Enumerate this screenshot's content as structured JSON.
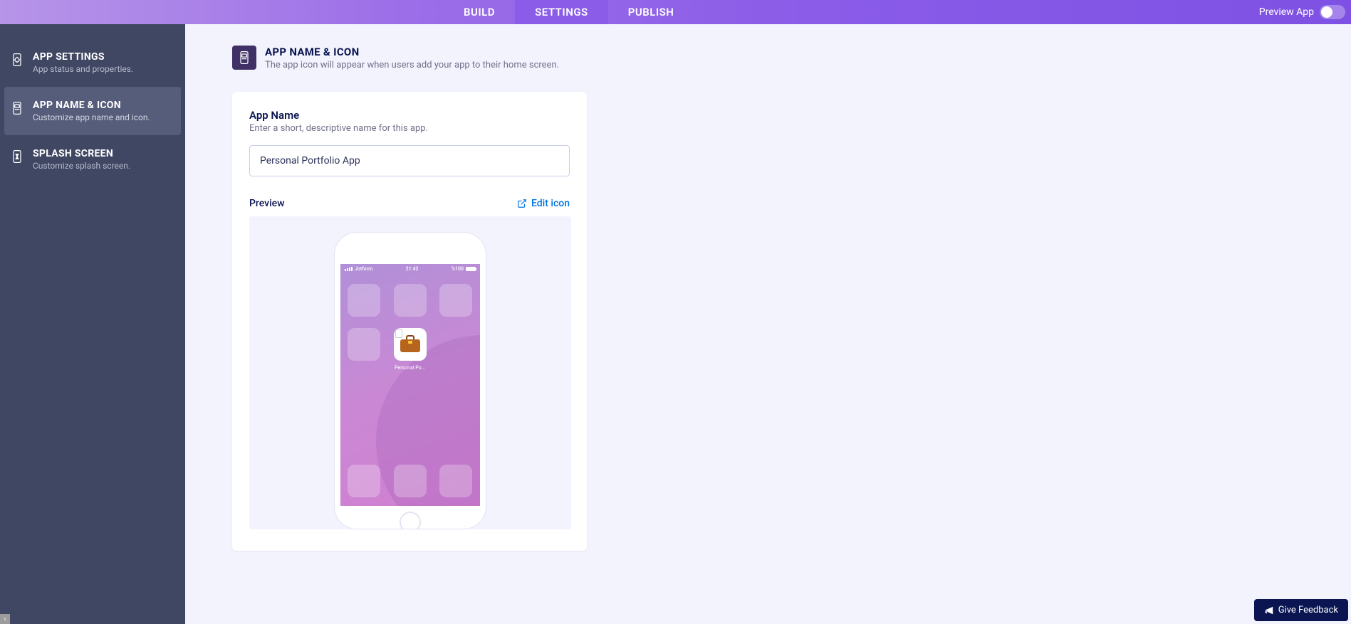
{
  "topbar": {
    "tabs": [
      {
        "label": "BUILD"
      },
      {
        "label": "SETTINGS"
      },
      {
        "label": "PUBLISH"
      }
    ],
    "preview_label": "Preview App"
  },
  "sidebar": {
    "items": [
      {
        "title": "APP SETTINGS",
        "desc": "App status and properties."
      },
      {
        "title": "APP NAME & ICON",
        "desc": "Customize app name and icon."
      },
      {
        "title": "SPLASH SCREEN",
        "desc": "Customize splash screen."
      }
    ]
  },
  "header": {
    "title": "APP NAME & ICON",
    "subtitle": "The app icon will appear when users add your app to their home screen."
  },
  "form": {
    "name_label": "App Name",
    "name_hint": "Enter a short, descriptive name for this app.",
    "name_value": "Personal Portfolio App",
    "preview_label": "Preview",
    "edit_icon_label": "Edit icon"
  },
  "phone": {
    "carrier": "Jotform",
    "time": "21:42",
    "battery_pct": "%100",
    "app_label": "Personal Po..."
  },
  "feedback": {
    "label": "Give Feedback"
  }
}
